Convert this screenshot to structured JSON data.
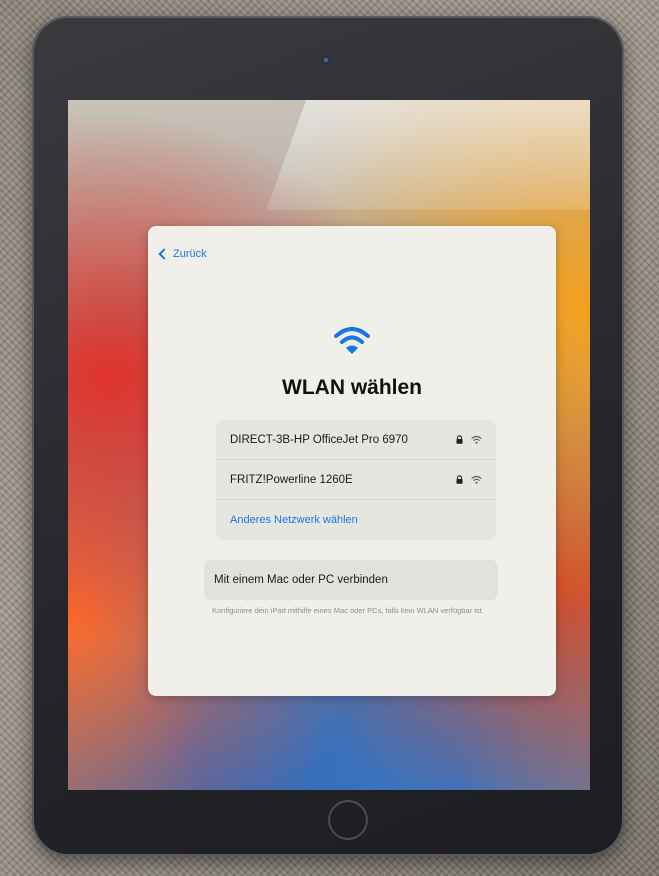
{
  "back": {
    "label": "Zurück"
  },
  "page": {
    "title": "WLAN wählen"
  },
  "networks": [
    {
      "name": "DIRECT-3B-HP OfficeJet Pro 6970",
      "secured": true,
      "icon": "wifi-icon"
    },
    {
      "name": "FRITZ!Powerline 1260E",
      "secured": true,
      "icon": "wifi-icon"
    }
  ],
  "other_network": {
    "label": "Anderes Netzwerk wählen"
  },
  "connect": {
    "label": "Mit einem Mac oder PC verbinden",
    "hint": "Konfiguriere dein iPad mithilfe eines Mac oder PCs, falls kein WLAN verfügbar ist."
  },
  "colors": {
    "accent": "#1877e8",
    "dialog_background": "#f0efea"
  }
}
